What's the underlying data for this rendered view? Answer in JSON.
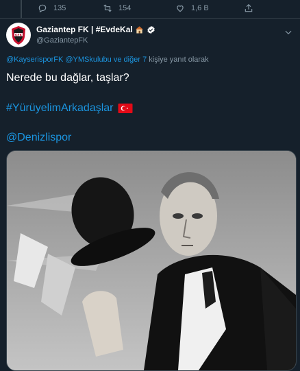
{
  "actions": {
    "reply": {
      "icon": "reply-icon",
      "count": "135"
    },
    "retweet": {
      "icon": "retweet-icon",
      "count": "154"
    },
    "like": {
      "icon": "heart-icon",
      "count": "1,6 B"
    },
    "share": {
      "icon": "share-icon"
    }
  },
  "tweet": {
    "display_name": "Gaziantep FK | #EvdeKal",
    "handle": "@GaziantepFK",
    "reply_to": {
      "mention1": "@KayserisporFK",
      "mention2": "@YMSkulubu",
      "connector": "ve",
      "others": "diğer 7",
      "suffix": "kişiye yanıt olarak"
    },
    "text": "Nerede bu dağlar, taşlar?",
    "hashtag": "#YürüyelimArkadaşlar",
    "mention": "@Denizlispor",
    "media": {
      "description_icon": "photo"
    }
  },
  "colors": {
    "background": "#15202b",
    "accent": "#1b95e0",
    "muted": "#8899a6",
    "border": "#38444d"
  }
}
